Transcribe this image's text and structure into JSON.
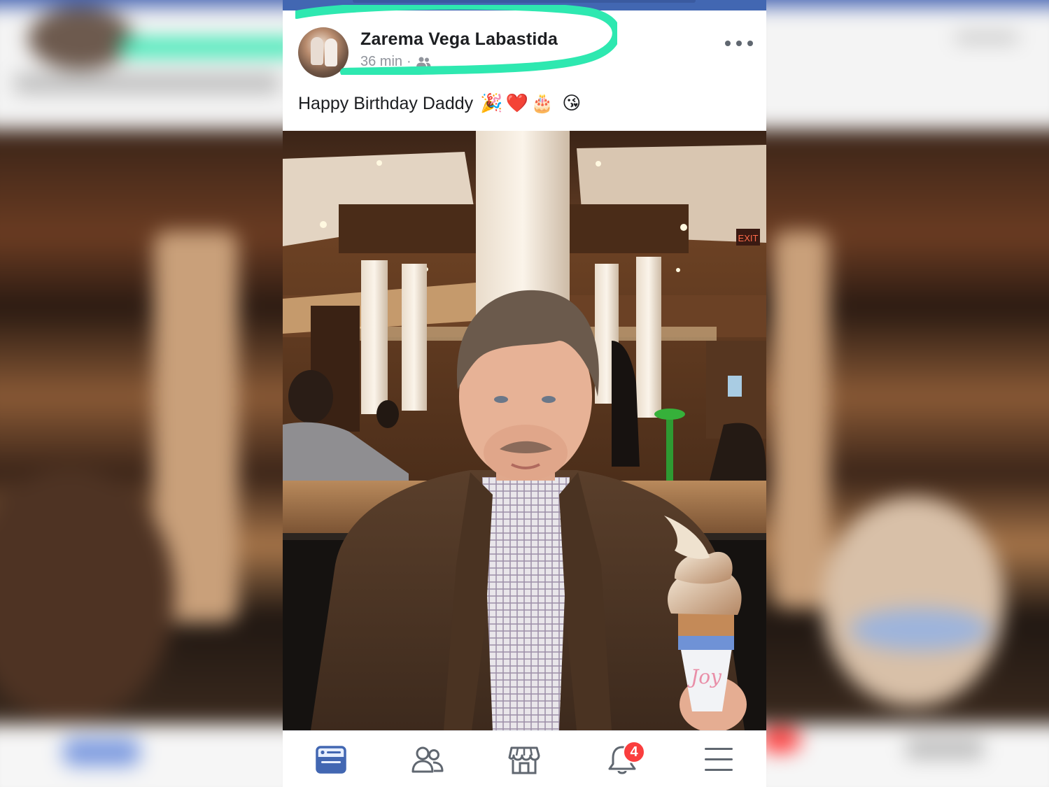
{
  "post": {
    "author": "Zarema Vega Labastida",
    "time": "36 min",
    "separator": "·",
    "audience_icon": "friends-icon",
    "caption_text": "Happy Birthday Daddy",
    "caption_emojis": [
      "🎉",
      "❤️",
      "🎂",
      "😘"
    ],
    "more_icon": "more-options-icon"
  },
  "photo": {
    "exit_sign": "EXIT",
    "cone_text": "Joy"
  },
  "bottom_nav": {
    "items": [
      {
        "icon": "news-feed-icon",
        "active": true
      },
      {
        "icon": "friends-icon",
        "active": false
      },
      {
        "icon": "marketplace-icon",
        "active": false
      },
      {
        "icon": "notifications-icon",
        "active": false,
        "badge": "4"
      },
      {
        "icon": "menu-icon",
        "active": false
      }
    ]
  },
  "colors": {
    "brand_blue": "#4267b2",
    "highlight_green": "#2ee8b0",
    "badge_red": "#fa3e3e",
    "icon_grey": "#606770"
  }
}
